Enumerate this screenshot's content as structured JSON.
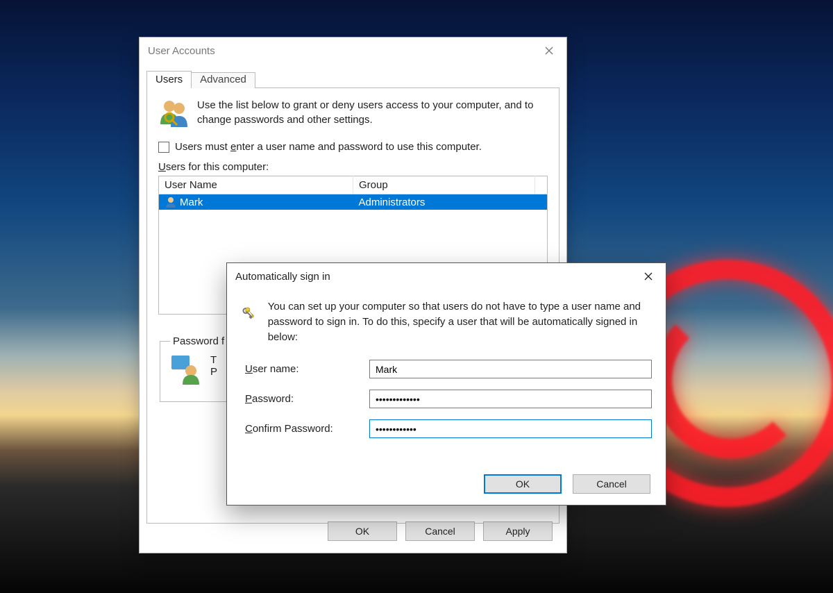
{
  "ua": {
    "title": "User Accounts",
    "tabs": {
      "users": "Users",
      "advanced": "Advanced"
    },
    "intro": "Use the list below to grant or deny users access to your computer, and to change passwords and other settings.",
    "checkbox": {
      "prefix": "Users must ",
      "underlined_char": "e",
      "suffix": "nter a user name and password to use this computer."
    },
    "list_label": {
      "underlined_char": "U",
      "rest": "sers for this computer:"
    },
    "columns": {
      "name": "User Name",
      "group": "Group"
    },
    "row": {
      "name": "Mark",
      "group": "Administrators"
    },
    "pw_legend_visible": "Password f",
    "pw_body_visible": "T\nP",
    "buttons": {
      "ok": "OK",
      "cancel": "Cancel",
      "apply": "Apply"
    }
  },
  "auto": {
    "title": "Automatically sign in",
    "intro": "You can set up your computer so that users do not have to type a user name and password to sign in. To do this, specify a user that will be automatically signed in below:",
    "fields": {
      "username_label_pre": "",
      "username_label_u": "U",
      "username_label_post": "ser name:",
      "password_label_pre": "",
      "password_label_u": "P",
      "password_label_post": "assword:",
      "confirm_label_pre": "",
      "confirm_label_u": "C",
      "confirm_label_post": "onfirm Password:"
    },
    "values": {
      "username": "Mark",
      "password": "•••••••••••••",
      "confirm": "••••••••••••"
    },
    "buttons": {
      "ok": "OK",
      "cancel": "Cancel"
    }
  }
}
